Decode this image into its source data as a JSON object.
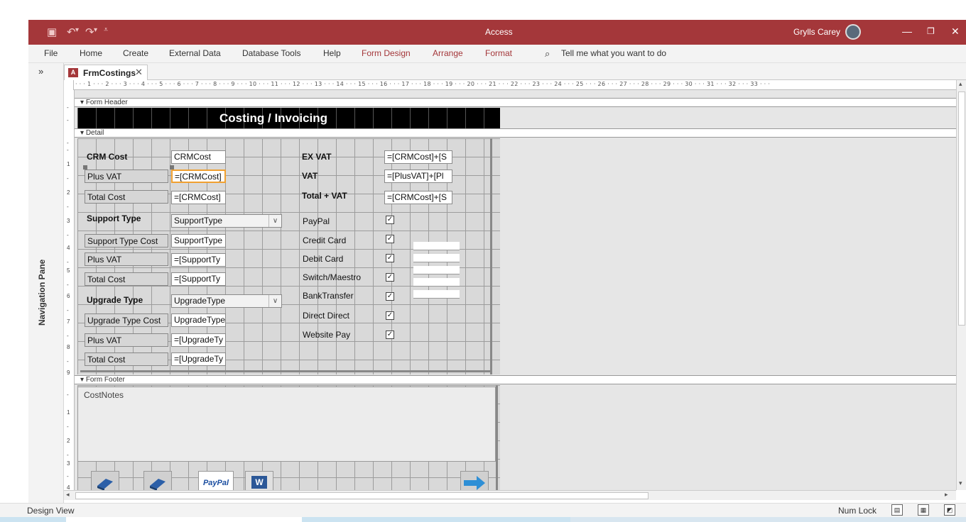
{
  "titlebar": {
    "app_title": "Access",
    "user_name": "Grylls Carey",
    "save_icon": "save-icon",
    "undo_icon": "undo-icon",
    "redo_icon": "redo-icon",
    "qat_icon": "customize-qat-icon",
    "min_label": "—",
    "max_label": "❐",
    "close_label": "✕"
  },
  "ribbon": {
    "tabs": [
      "File",
      "Home",
      "Create",
      "External Data",
      "Database Tools",
      "Help",
      "Form Design",
      "Arrange",
      "Format"
    ],
    "search_placeholder": "Tell me what you want to do"
  },
  "navpane": {
    "label": "Navigation Pane",
    "toggle": "»"
  },
  "doc_tab": {
    "label": "FrmCostings",
    "badge": "A",
    "close": "✕"
  },
  "ruler": {
    "ticks": "· · · 1 · · · 2 · · · 3 · · · 4 · · · 5 · · · 6 · · · 7 · · · 8 · · · 9 · · · 10 · · · 11 · · · 12 · · · 13 · · · 14 · · · 15 · · · 16 · · · 17 · · · 18 · · · 19 · · · 20 · · · 21 · · · 22 · · · 23 · · · 24 · · · 25 · · · 26 · · · 27 · · · 28 · · · 29 · · · 30 · · · 31 · · · 32 · · · 33 · · ·"
  },
  "sections": {
    "header": "Form Header",
    "detail": "Detail",
    "footer": "Form Footer"
  },
  "form": {
    "title": "Costing / Invoicing",
    "left": {
      "crm_cost_label": "CRM Cost",
      "crm_cost_value": "CRMCost",
      "plus_vat1_label": "Plus VAT",
      "plus_vat1_value": "=[CRMCost]",
      "total_cost1_label": "Total Cost",
      "total_cost1_value": "=[CRMCost]",
      "support_type_label": "Support Type",
      "support_type_value": "SupportType",
      "support_type_cost_label": "Support Type Cost",
      "support_type_cost_value": "SupportType",
      "plus_vat2_label": "Plus VAT",
      "plus_vat2_value": "=[SupportTy",
      "total_cost2_label": "Total Cost",
      "total_cost2_value": "=[SupportTy",
      "upgrade_type_label": "Upgrade Type",
      "upgrade_type_value": "UpgradeType",
      "upgrade_type_cost_label": "Upgrade Type Cost",
      "upgrade_type_cost_value": "UpgradeType",
      "plus_vat3_label": "Plus VAT",
      "plus_vat3_value": "=[UpgradeTy",
      "total_cost3_label": "Total Cost",
      "total_cost3_value": "=[UpgradeTy"
    },
    "right": {
      "ex_vat_label": "EX VAT",
      "ex_vat_value": "=[CRMCost]+[S",
      "vat_label": "VAT",
      "vat_value": "=[PlusVAT]+[Pl",
      "total_vat_label": "Total + VAT",
      "total_vat_value": "=[CRMCost]+[S"
    },
    "payments": [
      "PayPal",
      "Credit Card",
      "Debit Card",
      "Switch/Maestro",
      "BankTransfer",
      "Direct Direct",
      "Website Pay"
    ],
    "check_glyph": "✓",
    "footer_notes": "CostNotes",
    "buttons": {
      "paypal": "PayPal",
      "word": "W"
    }
  },
  "status": {
    "view": "Design View",
    "numlock": "Num Lock"
  },
  "colors": {
    "accent": "#a4373a",
    "grid": "#d9d9d9",
    "selected": "#f0a030"
  }
}
